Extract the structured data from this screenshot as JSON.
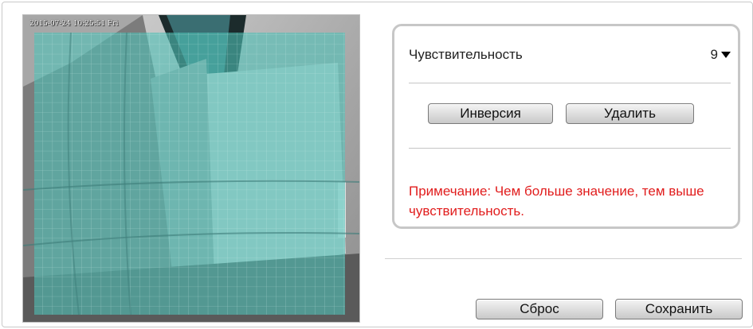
{
  "video": {
    "osd_timestamp": "2015-07-24 10:25:51 Fri",
    "overlay_color": "#5fc8c0"
  },
  "settings": {
    "sensitivity_label": "Чувствительность",
    "sensitivity_value": "9",
    "invert_button": "Инверсия",
    "delete_button": "Удалить",
    "note": "Примечание: Чем больше значение, тем выше чувствительность.",
    "note_color": "#e11d1d"
  },
  "footer": {
    "reset_button": "Сброс",
    "save_button": "Сохранить"
  },
  "icons": {
    "dropdown": "chevron-down-icon"
  }
}
